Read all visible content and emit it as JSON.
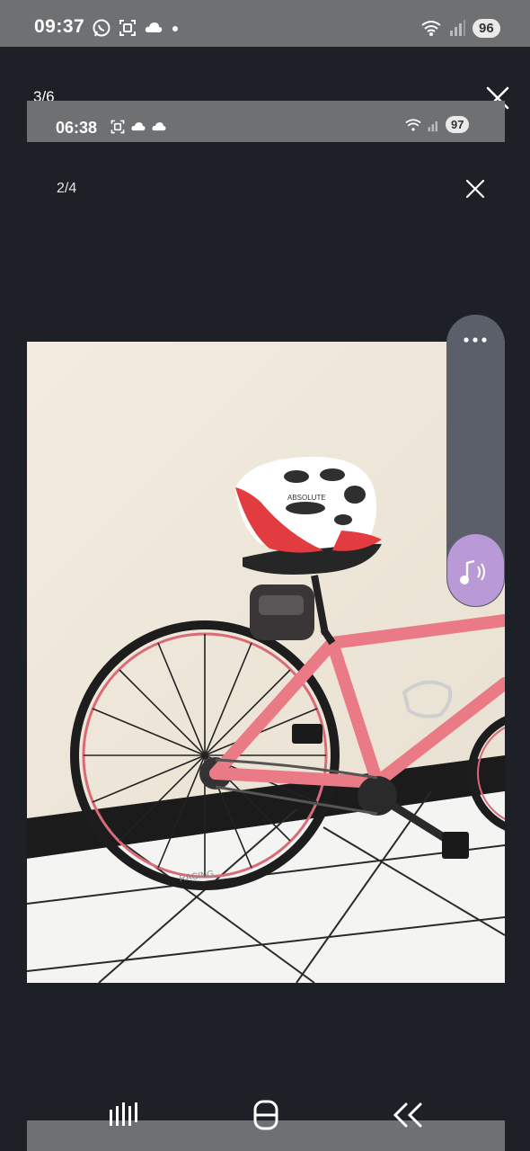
{
  "status_bar": {
    "time": "09:37",
    "battery": "96",
    "icons": [
      "whatsapp-icon",
      "screenshot-icon",
      "cloud-icon",
      "dot-icon",
      "wifi-icon",
      "signal-icon"
    ]
  },
  "viewer": {
    "counter": "3/6"
  },
  "inner_status_bar": {
    "time": "06:38",
    "battery": "97",
    "icons": [
      "screenshot-icon",
      "cloud-icon",
      "cloud-icon",
      "wifi-icon",
      "signal-icon"
    ]
  },
  "inner_viewer": {
    "counter": "2/4"
  },
  "side_panel": {
    "icons": [
      "more-icon",
      "music-icon"
    ]
  },
  "photo": {
    "helmet_brand": "ABSOLUTE",
    "rim_text": "RACING"
  },
  "nav_bar": {
    "icons": [
      "recent-apps-icon",
      "home-icon",
      "back-icon"
    ]
  },
  "colors": {
    "background": "#1d2026",
    "status_bar": "#6f7072",
    "panel": "#5b5f69",
    "music_accent": "#b99ad6",
    "bike_frame": "#e97a86"
  }
}
